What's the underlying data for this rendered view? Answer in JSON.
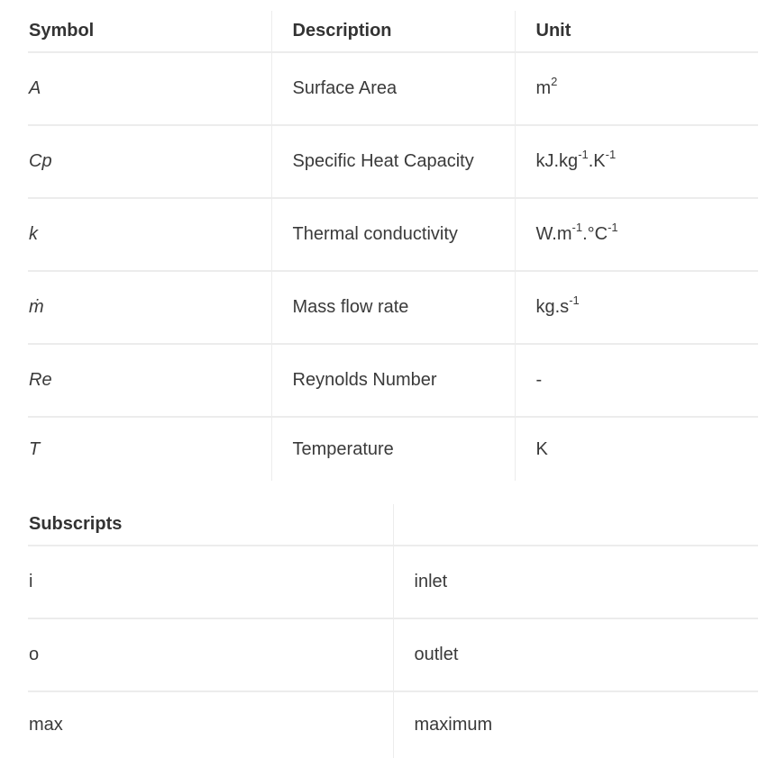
{
  "nomenclature": {
    "headers": [
      "Symbol",
      "Description",
      "Unit"
    ],
    "rows": [
      {
        "symbol": "A",
        "description": "Surface Area",
        "unit_parts": [
          {
            "t": "m"
          },
          {
            "sup": "2"
          }
        ]
      },
      {
        "symbol": "Cp",
        "description": "Specific Heat Capacity",
        "unit_parts": [
          {
            "t": "kJ.kg"
          },
          {
            "sup": "-1"
          },
          {
            "t": ".K"
          },
          {
            "sup": "-1"
          }
        ]
      },
      {
        "symbol": "k",
        "description": "Thermal conductivity",
        "unit_parts": [
          {
            "t": "W.m"
          },
          {
            "sup": "-1"
          },
          {
            "t": ".°C"
          },
          {
            "sup": "-1"
          }
        ]
      },
      {
        "symbol": "ṁ",
        "description": "Mass flow rate",
        "unit_parts": [
          {
            "t": "kg.s"
          },
          {
            "sup": "-1"
          }
        ]
      },
      {
        "symbol": "Re",
        "description": "Reynolds Number",
        "unit_parts": [
          {
            "t": "-"
          }
        ]
      },
      {
        "symbol": "T",
        "description": "Temperature",
        "unit_parts": [
          {
            "t": "K"
          }
        ]
      }
    ]
  },
  "subscripts": {
    "headers": [
      "Subscripts",
      ""
    ],
    "rows": [
      {
        "symbol": "i",
        "meaning": "inlet"
      },
      {
        "symbol": "o",
        "meaning": "outlet"
      },
      {
        "symbol": "max",
        "meaning": "maximum"
      }
    ]
  }
}
